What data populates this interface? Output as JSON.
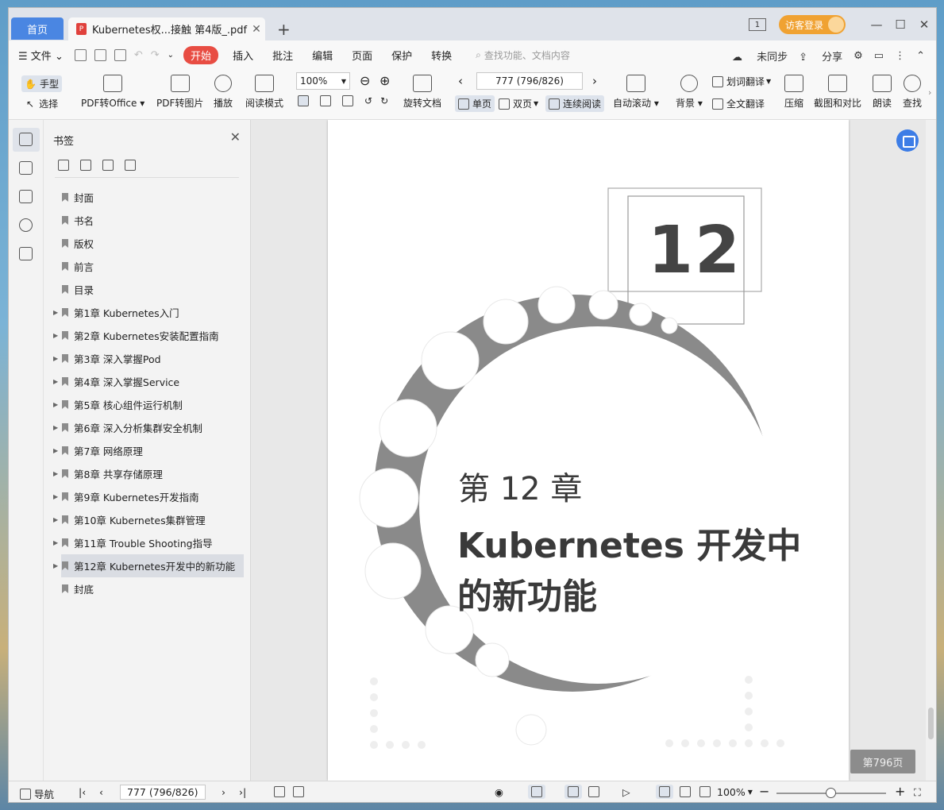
{
  "tabs": {
    "home": "首页",
    "document": "Kubernetes权...接触 第4版_.pdf"
  },
  "title_right": {
    "page_indicator": "1",
    "login": "访客登录"
  },
  "menu": {
    "file": "文件",
    "start": "开始",
    "items": [
      "插入",
      "批注",
      "编辑",
      "页面",
      "保护",
      "转换"
    ],
    "search_placeholder": "查找功能、文档内容",
    "sync": "未同步",
    "share": "分享"
  },
  "toolbar": {
    "hand": "手型",
    "select": "选择",
    "pdf_to_office": "PDF转Office",
    "pdf_to_image": "PDF转图片",
    "play": "播放",
    "read_mode": "阅读模式",
    "zoom": "100%",
    "rotate": "旋转文档",
    "page_input": "777 (796/826)",
    "single": "单页",
    "double": "双页",
    "continuous": "连续阅读",
    "auto_scroll": "自动滚动",
    "background": "背景",
    "word_translate": "划词翻译",
    "full_translate": "全文翻译",
    "compress": "压缩",
    "screenshot_compare": "截图和对比",
    "read_aloud": "朗读",
    "find": "查找"
  },
  "panel": {
    "title": "书签",
    "bookmarks": [
      {
        "label": "封面",
        "expandable": false
      },
      {
        "label": "书名",
        "expandable": false
      },
      {
        "label": "版权",
        "expandable": false
      },
      {
        "label": "前言",
        "expandable": false
      },
      {
        "label": "目录",
        "expandable": false
      },
      {
        "label": "第1章 Kubernetes入门",
        "expandable": true
      },
      {
        "label": "第2章 Kubernetes安装配置指南",
        "expandable": true
      },
      {
        "label": "第3章 深入掌握Pod",
        "expandable": true
      },
      {
        "label": "第4章 深入掌握Service",
        "expandable": true
      },
      {
        "label": "第5章 核心组件运行机制",
        "expandable": true
      },
      {
        "label": "第6章 深入分析集群安全机制",
        "expandable": true
      },
      {
        "label": "第7章 网络原理",
        "expandable": true
      },
      {
        "label": "第8章 共享存储原理",
        "expandable": true
      },
      {
        "label": "第9章 Kubernetes开发指南",
        "expandable": true
      },
      {
        "label": "第10章 Kubernetes集群管理",
        "expandable": true
      },
      {
        "label": "第11章 Trouble Shooting指导",
        "expandable": true
      },
      {
        "label": "第12章 Kubernetes开发中的新功能",
        "expandable": true
      },
      {
        "label": "封底",
        "expandable": false
      }
    ]
  },
  "page": {
    "chapter_number": "12",
    "chapter_label": "第 12 章",
    "chapter_title_line1": "Kubernetes 开发中",
    "chapter_title_line2": "的新功能"
  },
  "page_badge": "第796页",
  "status": {
    "nav": "导航",
    "page_input": "777 (796/826)",
    "zoom": "100%"
  }
}
